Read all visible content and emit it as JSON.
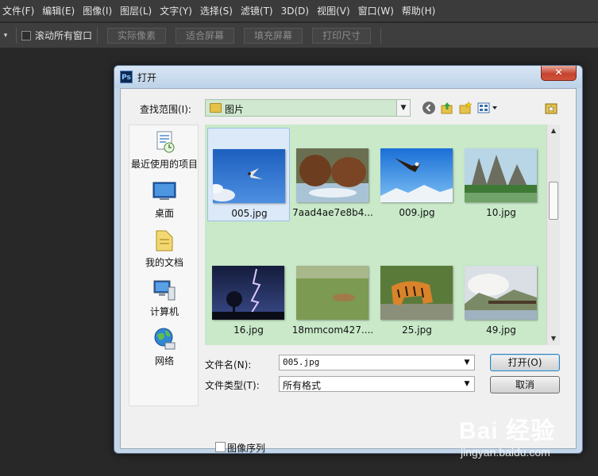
{
  "app": {
    "menus": [
      "文件(F)",
      "编辑(E)",
      "图像(I)",
      "图层(L)",
      "文字(Y)",
      "选择(S)",
      "滤镜(T)",
      "3D(D)",
      "视图(V)",
      "窗口(W)",
      "帮助(H)"
    ],
    "options": {
      "scroll_all_windows": "滚动所有窗口",
      "buttons": [
        "实际像素",
        "适合屏幕",
        "填充屏幕",
        "打印尺寸"
      ]
    }
  },
  "dialog": {
    "title": "打开",
    "app_icon_text": "Ps",
    "close_label": "✕",
    "look_in_label": "查找范围(I):",
    "look_in_value": "图片",
    "places": [
      "最近使用的项目",
      "桌面",
      "我的文档",
      "计算机",
      "网络"
    ],
    "files": [
      {
        "name": "005.jpg",
        "selected": true
      },
      {
        "name": "7aad4ae7e8b4...",
        "selected": false
      },
      {
        "name": "009.jpg",
        "selected": false
      },
      {
        "name": "10.jpg",
        "selected": false
      },
      {
        "name": "16.jpg",
        "selected": false
      },
      {
        "name": "18mmcom427....",
        "selected": false
      },
      {
        "name": "25.jpg",
        "selected": false
      },
      {
        "name": "49.jpg",
        "selected": false
      }
    ],
    "filename_label": "文件名(N):",
    "filename_value": "005.jpg",
    "filetype_label": "文件类型(T):",
    "filetype_value": "所有格式",
    "open_button": "打开(O)",
    "cancel_button": "取消",
    "image_sequence_label": "图像序列",
    "image_sequence_checked": false
  },
  "watermark": {
    "brand": "Bai 经验",
    "url": "jingyan.baidu.com"
  },
  "colors": {
    "file_list_bg": "#c9e9c9",
    "selection": "#dbe9f8"
  }
}
